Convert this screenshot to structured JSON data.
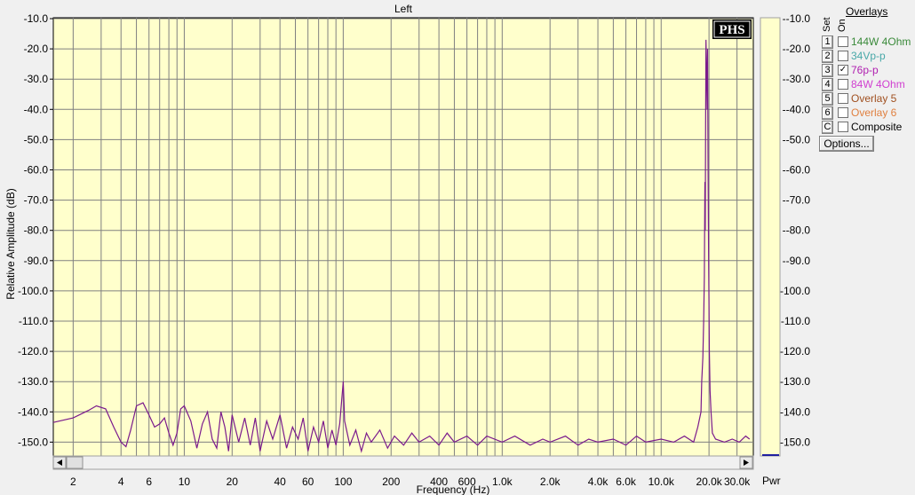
{
  "chart_data": {
    "type": "line",
    "title": "Left",
    "xlabel": "Frequency (Hz)",
    "ylabel": "Relative Amplitude (dB)",
    "x_scale": "log",
    "xlim": [
      1.5,
      38000
    ],
    "ylim": [
      -155,
      -10
    ],
    "y_ticks": [
      "-10.0",
      "-20.0",
      "-30.0",
      "-40.0",
      "-50.0",
      "-60.0",
      "-70.0",
      "-80.0",
      "-90.0",
      "-100.0",
      "-110.0",
      "-120.0",
      "-130.0",
      "-140.0",
      "-150.0"
    ],
    "x_tick_values": [
      2,
      4,
      6,
      10,
      20,
      40,
      60,
      100,
      200,
      400,
      600,
      1000,
      2000,
      4000,
      6000,
      10000,
      20000,
      30000
    ],
    "x_tick_labels": [
      "2",
      "4",
      "6",
      "10",
      "20",
      "40",
      "60",
      "100",
      "200",
      "400",
      "600",
      "1.0k",
      "2.0k",
      "4.0k",
      "6.0k",
      "10.0k",
      "20.0k",
      "30.0k"
    ],
    "right_axis_label": "Pwr",
    "grid": true,
    "series": [
      {
        "color": "#7a1a8c",
        "points": [
          [
            1.5,
            -143.5
          ],
          [
            2,
            -142
          ],
          [
            2.5,
            -139.5
          ],
          [
            2.8,
            -138
          ],
          [
            3.2,
            -139
          ],
          [
            3.6,
            -145
          ],
          [
            4,
            -150
          ],
          [
            4.3,
            -151.5
          ],
          [
            4.6,
            -146
          ],
          [
            5,
            -138
          ],
          [
            5.5,
            -137
          ],
          [
            6,
            -141
          ],
          [
            6.5,
            -145
          ],
          [
            7,
            -144
          ],
          [
            7.5,
            -142
          ],
          [
            8,
            -147
          ],
          [
            8.5,
            -151
          ],
          [
            9,
            -147
          ],
          [
            9.5,
            -139
          ],
          [
            10,
            -138
          ],
          [
            11,
            -143
          ],
          [
            12,
            -152
          ],
          [
            13,
            -144
          ],
          [
            14,
            -140
          ],
          [
            15,
            -149
          ],
          [
            16,
            -152
          ],
          [
            17,
            -140
          ],
          [
            18,
            -145
          ],
          [
            19,
            -153
          ],
          [
            20,
            -141
          ],
          [
            22,
            -150
          ],
          [
            24,
            -142
          ],
          [
            26,
            -151
          ],
          [
            28,
            -142
          ],
          [
            30,
            -153
          ],
          [
            33,
            -143
          ],
          [
            36,
            -149
          ],
          [
            40,
            -141
          ],
          [
            44,
            -152
          ],
          [
            48,
            -145
          ],
          [
            52,
            -149
          ],
          [
            56,
            -142
          ],
          [
            60,
            -153
          ],
          [
            65,
            -145
          ],
          [
            70,
            -150
          ],
          [
            75,
            -143
          ],
          [
            80,
            -152
          ],
          [
            85,
            -146
          ],
          [
            90,
            -151
          ],
          [
            95,
            -144
          ],
          [
            100,
            -130
          ],
          [
            102,
            -143
          ],
          [
            110,
            -151
          ],
          [
            120,
            -146
          ],
          [
            130,
            -153
          ],
          [
            140,
            -147
          ],
          [
            150,
            -150
          ],
          [
            170,
            -146
          ],
          [
            190,
            -152
          ],
          [
            210,
            -148
          ],
          [
            240,
            -151
          ],
          [
            270,
            -147
          ],
          [
            300,
            -150
          ],
          [
            350,
            -148
          ],
          [
            400,
            -151
          ],
          [
            450,
            -147
          ],
          [
            500,
            -150
          ],
          [
            600,
            -148
          ],
          [
            700,
            -151
          ],
          [
            800,
            -148
          ],
          [
            1000,
            -150
          ],
          [
            1200,
            -148
          ],
          [
            1500,
            -151
          ],
          [
            1800,
            -149
          ],
          [
            2000,
            -150
          ],
          [
            2500,
            -148
          ],
          [
            3000,
            -151
          ],
          [
            3500,
            -149
          ],
          [
            4000,
            -150
          ],
          [
            5000,
            -149
          ],
          [
            6000,
            -151
          ],
          [
            7000,
            -148
          ],
          [
            8000,
            -150
          ],
          [
            10000,
            -149
          ],
          [
            12000,
            -150
          ],
          [
            14000,
            -148
          ],
          [
            16000,
            -150
          ],
          [
            17000,
            -145
          ],
          [
            17800,
            -140
          ],
          [
            18000,
            -130
          ],
          [
            18300,
            -122
          ],
          [
            18500,
            -110
          ],
          [
            18700,
            -95
          ],
          [
            18850,
            -64
          ],
          [
            18950,
            -80
          ],
          [
            19050,
            -45
          ],
          [
            19150,
            -17
          ],
          [
            19300,
            -28
          ],
          [
            19450,
            -40
          ],
          [
            19600,
            -20
          ],
          [
            19750,
            -60
          ],
          [
            19900,
            -90
          ],
          [
            20100,
            -120
          ],
          [
            20300,
            -133
          ],
          [
            20600,
            -140
          ],
          [
            21000,
            -147
          ],
          [
            22000,
            -149
          ],
          [
            25000,
            -150
          ],
          [
            28000,
            -149
          ],
          [
            31000,
            -150
          ],
          [
            34000,
            -148
          ],
          [
            36000,
            -149
          ]
        ]
      }
    ],
    "plot_bg": "#ffffcc",
    "grid_color": "#808080"
  },
  "overlays": {
    "title": "Overlays",
    "set_header": "Set",
    "on_header": "On",
    "items": [
      {
        "set": "1",
        "label": "144W 4Ohm",
        "checked": false,
        "color": "#3a8a3a"
      },
      {
        "set": "2",
        "label": "34Vp-p",
        "checked": false,
        "color": "#48a8a8"
      },
      {
        "set": "3",
        "label": "76p-p",
        "checked": true,
        "color": "#b020b0"
      },
      {
        "set": "4",
        "label": "84W 4Ohm",
        "checked": false,
        "color": "#d040d0"
      },
      {
        "set": "5",
        "label": "Overlay 5",
        "checked": false,
        "color": "#a05020"
      },
      {
        "set": "6",
        "label": "Overlay 6",
        "checked": false,
        "color": "#e08040"
      },
      {
        "set": "C",
        "label": "Composite",
        "checked": false,
        "color": "#000000"
      }
    ],
    "options_label": "Options..."
  }
}
